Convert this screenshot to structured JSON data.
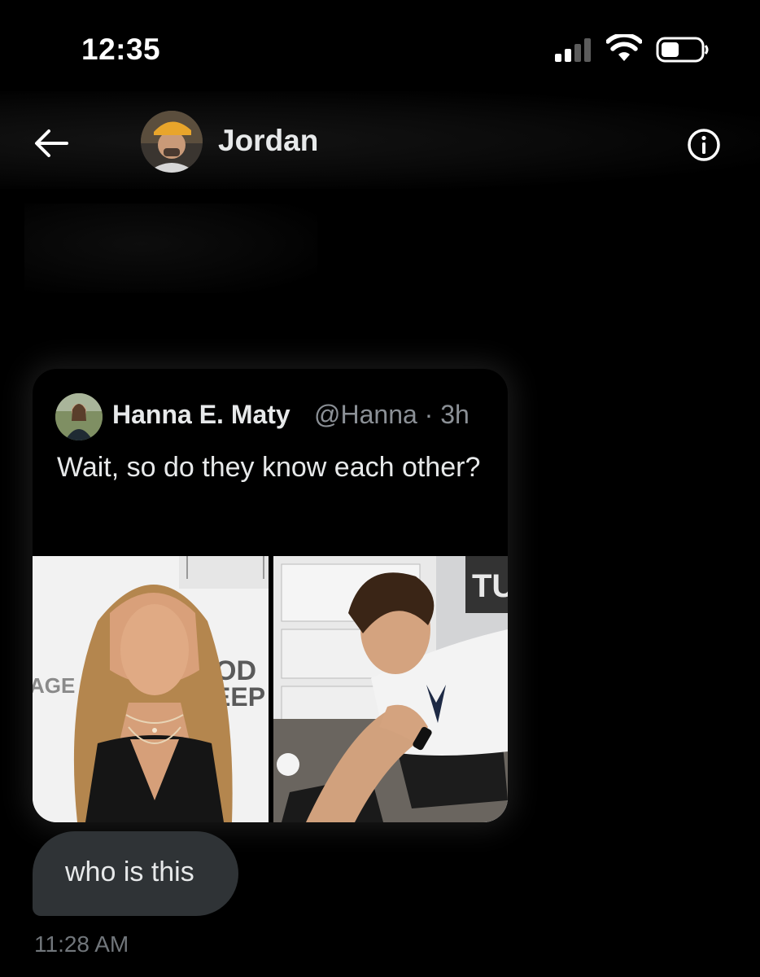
{
  "status_bar": {
    "time": "12:35",
    "icons": [
      "signal-icon",
      "wifi-icon",
      "battery-icon"
    ]
  },
  "header": {
    "contact_name": "Jordan",
    "icons": [
      "back-arrow-icon",
      "info-icon"
    ]
  },
  "quoted_post": {
    "author_name": "Hanna E. Maty",
    "handle": "@Hanna",
    "time": "3h",
    "separator": "·",
    "text": "Wait, so do they know each other?",
    "media": [
      {
        "type": "photo",
        "left_signage": "AGE",
        "right_signage_top": "OD",
        "right_signage_bottom": "EEP"
      },
      {
        "type": "photo",
        "signage": "TU"
      }
    ]
  },
  "message": {
    "text": "who is this",
    "timestamp": "11:28 AM"
  },
  "colors": {
    "background": "#000000",
    "text_primary": "#e7e9ea",
    "text_secondary": "#71767b",
    "bubble": "#2f3336"
  }
}
